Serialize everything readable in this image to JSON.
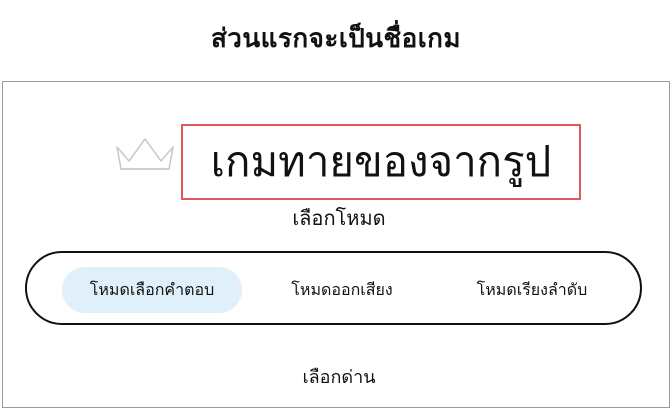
{
  "header": {
    "title": "ส่วนแรกจะเป็นชื่อเกม"
  },
  "game": {
    "title": "เกมทายของจากรูป",
    "title_icon": "crown-icon",
    "mode_label": "เลือกโหมด",
    "modes": [
      {
        "label": "โหมดเลือกคำตอบ",
        "selected": true
      },
      {
        "label": "โหมดออกเสียง",
        "selected": false
      },
      {
        "label": "โหมดเรียงลำดับ",
        "selected": false
      }
    ],
    "level_label": "เลือกด่าน"
  },
  "colors": {
    "title_border": "#e2595b",
    "selected_mode_bg": "#dff0fb",
    "frame_border": "#9a9a9a"
  }
}
